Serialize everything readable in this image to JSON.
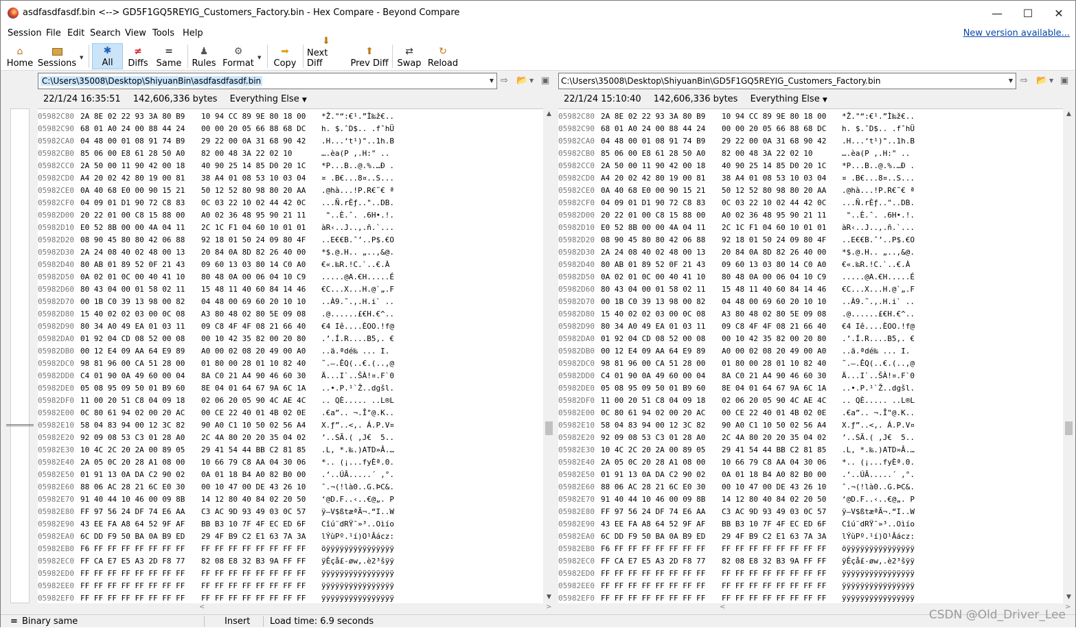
{
  "window": {
    "title": "asdfasdfasdf.bin <--> GD5F1GQ5REYIG_Customers_Factory.bin - Hex Compare - Beyond Compare",
    "minimize": "—",
    "maximize": "☐",
    "close": "✕"
  },
  "menu": {
    "items": [
      "Session",
      "File",
      "Edit",
      "Search",
      "View",
      "Tools",
      "Help"
    ],
    "new_version": "New version available..."
  },
  "toolbar": {
    "home": "Home",
    "sessions": "Sessions",
    "all": "All",
    "diffs": "Diffs",
    "same": "Same",
    "rules": "Rules",
    "format": "Format",
    "copy": "Copy",
    "next_diff": "Next Diff",
    "prev_diff": "Prev Diff",
    "swap": "Swap",
    "reload": "Reload"
  },
  "left": {
    "path": "C:\\Users\\35008\\Desktop\\ShiyuanBin\\asdfasdfasdf.bin",
    "date": "22/1/24 16:35:51",
    "size": "142,606,336 bytes",
    "filter": "Everything Else"
  },
  "right": {
    "path": "C:\\Users\\35008\\Desktop\\ShiyuanBin\\GD5F1GQ5REYIG_Customers_Factory.bin",
    "date": "22/1/24 15:10:40",
    "size": "142,606,336 bytes",
    "filter": "Everything Else"
  },
  "rows": [
    {
      "addr": "05982C80",
      "h1": "2A 8E 02 22 93 3A 80 B9",
      "h2": "10 94 CC 89 9E 80 18 00",
      "ascii": "*Ž.\"“:€¹.”Ì‰ž€.."
    },
    {
      "addr": "05982C90",
      "h1": "68 01 A0 24 00 88 44 24",
      "h2": "00 00 20 05 66 88 68 DC",
      "ascii": "h. $.ˆD$.. .fˆhÜ"
    },
    {
      "addr": "05982CA0",
      "h1": "04 48 00 01 08 91 74 B9",
      "h2": "29 22 00 0A 31 68 90 42",
      "ascii": ".H...‘t¹)\"..1h.B"
    },
    {
      "addr": "05982CB0",
      "h1": "85 06 00 E8 61 28 50 A0",
      "h2": "82 00 48 3A 22 02 10",
      "ascii": "….èa(P ‚.H:\" .."
    },
    {
      "addr": "05982CC0",
      "h1": "2A 50 00 11 90 42 00 18",
      "h2": "40 90 25 14 85 D0 20 1C",
      "ascii": "*P...B..@.%.…Ð ."
    },
    {
      "addr": "05982CD0",
      "h1": "A4 20 02 42 80 19 00 81",
      "h2": "38 A4 01 08 53 10 03 04",
      "ascii": "¤ .B€...8¤..S..."
    },
    {
      "addr": "05982CE0",
      "h1": "0A 40 68 E0 00 90 15 21",
      "h2": "50 12 52 80 98 80 20 AA",
      "ascii": ".@hà...!P.R€˜€ ª"
    },
    {
      "addr": "05982CF0",
      "h1": "04 09 01 D1 90 72 C8 83",
      "h2": "0C 03 22 10 02 44 42 0C",
      "ascii": "...Ñ.rÈƒ..\"..DB."
    },
    {
      "addr": "05982D00",
      "h1": "20 22 01 00 C8 15 88 00",
      "h2": "A0 02 36 48 95 90 21 11",
      "ascii": " \"..È.ˆ. .6H•.!."
    },
    {
      "addr": "05982D10",
      "h1": "E0 52 8B 00 00 4A 04 11",
      "h2": "2C 1C F1 04 60 10 01 01",
      "ascii": "àR‹..J..,.ñ.`..."
    },
    {
      "addr": "05982D20",
      "h1": "08 90 45 80 80 42 06 88",
      "h2": "92 18 01 50 24 09 80 4F",
      "ascii": "..E€€B.ˆ’..P$.€O"
    },
    {
      "addr": "05982D30",
      "h1": "2A 24 08 40 02 48 00 13",
      "h2": "20 84 0A 8D 82 26 40 00",
      "ascii": "*$.@.H.. „..‚&@."
    },
    {
      "addr": "05982D40",
      "h1": "80 AB 01 89 52 0F 21 43",
      "h2": "09 60 13 03 80 14 C0 A0",
      "ascii": "€«.‰R.!C.`..€.À "
    },
    {
      "addr": "05982D50",
      "h1": "0A 02 01 0C 00 40 41 10",
      "h2": "80 48 0A 00 06 04 10 C9",
      "ascii": ".....@A.€H.....É"
    },
    {
      "addr": "05982D60",
      "h1": "80 43 04 00 01 58 02 11",
      "h2": "15 48 11 40 60 84 14 46",
      "ascii": "€C...X...H.@`„.F"
    },
    {
      "addr": "05982D70",
      "h1": "00 1B C0 39 13 98 00 82",
      "h2": "04 48 00 69 60 20 10 10",
      "ascii": "..À9.˜.‚.H.i` .."
    },
    {
      "addr": "05982D80",
      "h1": "15 40 02 02 03 00 0C 08",
      "h2": "A3 80 48 02 80 5E 09 08",
      "ascii": ".@......£€H.€^.."
    },
    {
      "addr": "05982D90",
      "h1": "80 34 A0 49 EA 01 03 11",
      "h2": "09 C8 4F 4F 08 21 66 40",
      "ascii": "€4 Iê....ÈOO.!f@"
    },
    {
      "addr": "05982DA0",
      "h1": "01 92 04 CD 08 52 00 08",
      "h2": "00 10 42 35 82 00 20 80",
      "ascii": ".’.Í.R....B5‚. €"
    },
    {
      "addr": "05982DB0",
      "h1": "00 12 E4 09 AA 64 E9 89",
      "h2": "A0 00 02 08 20 49 00 A0",
      "ascii": "..ä.ªdé‰ ... I. "
    },
    {
      "addr": "05982DC0",
      "h1": "98 81 96 00 CA 51 28 00",
      "h2": "01 80 00 28 01 10 82 40",
      "ascii": "˜.–.ÊQ(..€.(..‚@"
    },
    {
      "addr": "05982DD0",
      "h1": "C4 01 90 0A 49 60 00 04",
      "h2": "8A C0 21 A4 90 46 60 30",
      "ascii": "Ä...I`..ŠÀ!¤.F`0"
    },
    {
      "addr": "05982DE0",
      "h1": "05 08 95 09 50 01 B9 60",
      "h2": "8E 04 01 64 67 9A 6C 1A",
      "ascii": "..•.P.¹`Ž..dgšl."
    },
    {
      "addr": "05982DF0",
      "h1": "11 00 20 51 C8 04 09 18",
      "h2": "02 06 20 05 90 4C AE 4C",
      "ascii": ".. QÈ..... ..L®L"
    },
    {
      "addr": "05982E00",
      "h1": "0C 80 61 94 02 00 20 AC",
      "h2": "00 CE 22 40 01 4B 02 0E",
      "ascii": ".€a”.. ¬.Î\"@.K.."
    },
    {
      "addr": "05982E10",
      "h1": "58 04 83 94 00 12 3C 82",
      "h2": "90 A0 C1 10 50 02 56 A4",
      "ascii": "X.ƒ”..<‚. Á.P.V¤"
    },
    {
      "addr": "05982E20",
      "h1": "92 09 08 53 C3 01 28 A0",
      "h2": "2C 4A 80 20 20 35 04 02",
      "ascii": "’..SÃ.( ,J€  5.."
    },
    {
      "addr": "05982E30",
      "h1": "10 4C 2C 20 2A 00 89 05",
      "h2": "29 41 54 44 BB C2 81 85",
      "ascii": ".L, *.‰.)ATD»Â.…"
    },
    {
      "addr": "05982E40",
      "h1": "2A 05 0C 20 28 A1 08 00",
      "h2": "10 66 79 C8 AA 04 30 06",
      "ascii": "*.. (¡...fyÈª.0."
    },
    {
      "addr": "05982E50",
      "h1": "01 91 13 0A DA C2 90 02",
      "h2": "0A 01 18 B4 A0 82 B0 00",
      "ascii": ".‘..ÚÂ.....´ ‚°."
    },
    {
      "addr": "05982E60",
      "h1": "88 06 AC 28 21 6C E0 30",
      "h2": "00 10 47 00 DE 43 26 10",
      "ascii": "ˆ.¬(!là0..G.ÞC&."
    },
    {
      "addr": "05982E70",
      "h1": "91 40 44 10 46 00 09 8B",
      "h2": "14 12 80 40 84 02 20 50",
      "ascii": "‘@D.F..‹..€@„. P"
    },
    {
      "addr": "05982E80",
      "h1": "FF 97 56 24 DF 74 E6 AA",
      "h2": "C3 AC 9D 93 49 03 0C 57",
      "ascii": "ÿ—V$ßtæªÃ¬.“I..W"
    },
    {
      "addr": "05982E90",
      "h1": "43 EE FA A8 64 52 9F AF",
      "h2": "BB B3 10 7F 4F EC ED 6F",
      "ascii": "Cîú¨dRŸ¯»³..Oìío"
    },
    {
      "addr": "05982EA0",
      "h1": "6C DD F9 50 BA 0A B9 ED",
      "h2": "29 4F B9 C2 E1 63 7A 3A",
      "ascii": "lÝùPº.¹í)O¹Âácz:"
    },
    {
      "addr": "05982EB0",
      "h1": "F6 FF FF FF FF FF FF FF",
      "h2": "FF FF FF FF FF FF FF FF",
      "ascii": "öÿÿÿÿÿÿÿÿÿÿÿÿÿÿÿ"
    },
    {
      "addr": "05982EC0",
      "h1": "FF CA E7 E5 A3 2D F8 77",
      "h2": "82 08 E8 32 B3 9A FF FF",
      "ascii": "ÿÊçå£-øw‚.è2³šÿÿ"
    },
    {
      "addr": "05982ED0",
      "h1": "FF FF FF FF FF FF FF FF",
      "h2": "FF FF FF FF FF FF FF FF",
      "ascii": "ÿÿÿÿÿÿÿÿÿÿÿÿÿÿÿÿ"
    },
    {
      "addr": "05982EE0",
      "h1": "FF FF FF FF FF FF FF FF",
      "h2": "FF FF FF FF FF FF FF FF",
      "ascii": "ÿÿÿÿÿÿÿÿÿÿÿÿÿÿÿÿ"
    },
    {
      "addr": "05982EF0",
      "h1": "FF FF FF FF FF FF FF FF",
      "h2": "FF FF FF FF FF FF FF FF",
      "ascii": "ÿÿÿÿÿÿÿÿÿÿÿÿÿÿÿÿ"
    }
  ],
  "status": {
    "icon": "=",
    "result": "Binary same",
    "mode": "Insert",
    "load_time": "Load time: 6.9 seconds"
  },
  "watermark": "CSDN @Old_Driver_Lee"
}
